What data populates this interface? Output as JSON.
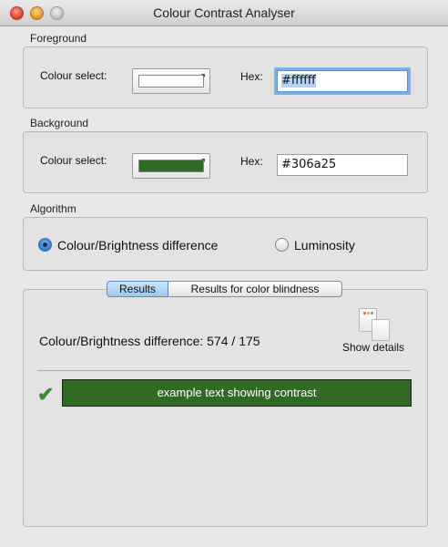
{
  "window": {
    "title": "Colour Contrast Analyser"
  },
  "foreground": {
    "group_label": "Foreground",
    "colour_select_label": "Colour select:",
    "hex_label": "Hex:",
    "hex_value": "#ffffff",
    "swatch_color": "#ffffff"
  },
  "background": {
    "group_label": "Background",
    "colour_select_label": "Colour select:",
    "hex_label": "Hex:",
    "hex_value": "#306a25",
    "swatch_color": "#306a25"
  },
  "algorithm": {
    "group_label": "Algorithm",
    "options": [
      {
        "label": "Colour/Brightness difference",
        "selected": true
      },
      {
        "label": "Luminosity",
        "selected": false
      }
    ]
  },
  "results": {
    "tabs": [
      {
        "label": "Results",
        "active": true
      },
      {
        "label": "Results for color blindness",
        "active": false
      }
    ],
    "summary_text": "Colour/Brightness difference: 574 / 175",
    "show_details_label": "Show details",
    "pass_icon": "checkmark-icon",
    "example_text": "example text showing contrast",
    "example_fg": "#ffffff",
    "example_bg": "#306a25"
  }
}
